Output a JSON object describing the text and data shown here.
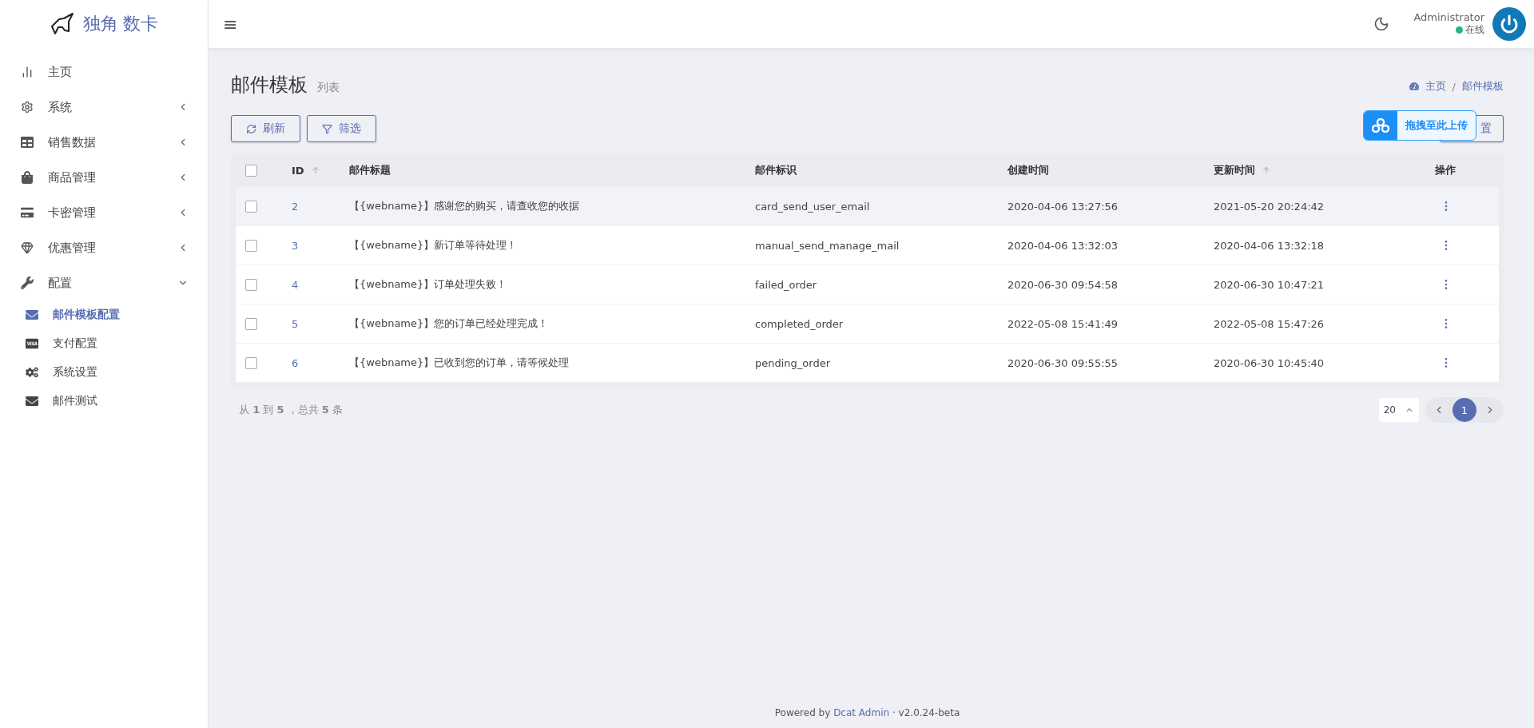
{
  "brand": {
    "name": "独角 数卡"
  },
  "sidebar": {
    "items": [
      {
        "kind": "link",
        "label": "主页"
      },
      {
        "kind": "group",
        "label": "系统",
        "expanded": false
      },
      {
        "kind": "group",
        "label": "销售数据",
        "expanded": false
      },
      {
        "kind": "group",
        "label": "商品管理",
        "expanded": false
      },
      {
        "kind": "group",
        "label": "卡密管理",
        "expanded": false
      },
      {
        "kind": "group",
        "label": "优惠管理",
        "expanded": false
      },
      {
        "kind": "group",
        "label": "配置",
        "expanded": true,
        "children": [
          {
            "label": "邮件模板配置",
            "selected": true
          },
          {
            "label": "支付配置",
            "selected": false
          },
          {
            "label": "系统设置",
            "selected": false
          },
          {
            "label": "邮件测试",
            "selected": false
          }
        ]
      }
    ]
  },
  "header": {
    "menu_toggle": "≡",
    "user": {
      "name": "Administrator",
      "status": "在线",
      "online": true
    }
  },
  "page": {
    "title": "邮件模板",
    "subtitle": "列表",
    "breadcrumb": [
      "主页",
      "邮件模板"
    ],
    "breadcrumb_separator": "/"
  },
  "toolbar": {
    "buttons": [
      "刷新",
      "筛选"
    ],
    "right_button": "置"
  },
  "upload_overlay": {
    "label": "拖拽至此上传"
  },
  "table": {
    "select_all_checked": false,
    "columns": [
      {
        "label": "ID",
        "sortable": true
      },
      {
        "label": "邮件标题",
        "sortable": false
      },
      {
        "label": "邮件标识",
        "sortable": false
      },
      {
        "label": "创建时间",
        "sortable": false
      },
      {
        "label": "更新时间",
        "sortable": true
      },
      {
        "label": "操作",
        "sortable": false
      }
    ],
    "rows": [
      {
        "hovered": true,
        "checked": false,
        "cells": [
          "2",
          "【{webname}】感谢您的购买，请查收您的收据",
          "card_send_user_email",
          "2020-04-06 13:27:56",
          "2021-05-20 20:24:42"
        ]
      },
      {
        "hovered": false,
        "checked": false,
        "cells": [
          "3",
          "【{webname}】新订单等待处理！",
          "manual_send_manage_mail",
          "2020-04-06 13:32:03",
          "2020-04-06 13:32:18"
        ]
      },
      {
        "hovered": false,
        "checked": false,
        "cells": [
          "4",
          "【{webname}】订单处理失败！",
          "failed_order",
          "2020-06-30 09:54:58",
          "2020-06-30 10:47:21"
        ]
      },
      {
        "hovered": false,
        "checked": false,
        "cells": [
          "5",
          "【{webname}】您的订单已经处理完成！",
          "completed_order",
          "2022-05-08 15:41:49",
          "2022-05-08 15:47:26"
        ]
      },
      {
        "hovered": false,
        "checked": false,
        "cells": [
          "6",
          "【{webname}】已收到您的订单，请等候处理",
          "pending_order",
          "2020-06-30 09:55:55",
          "2020-06-30 10:45:40"
        ]
      }
    ]
  },
  "pagination": {
    "summary": "从 **1** 到 **5** ，总共 **5** 条",
    "per_page": "20",
    "pages": [
      {
        "label": "1",
        "selected": true
      }
    ]
  },
  "footer": {
    "prefix": "Powered by",
    "link": "Dcat Admin",
    "separator": "·",
    "version": "v2.0.24-beta"
  }
}
